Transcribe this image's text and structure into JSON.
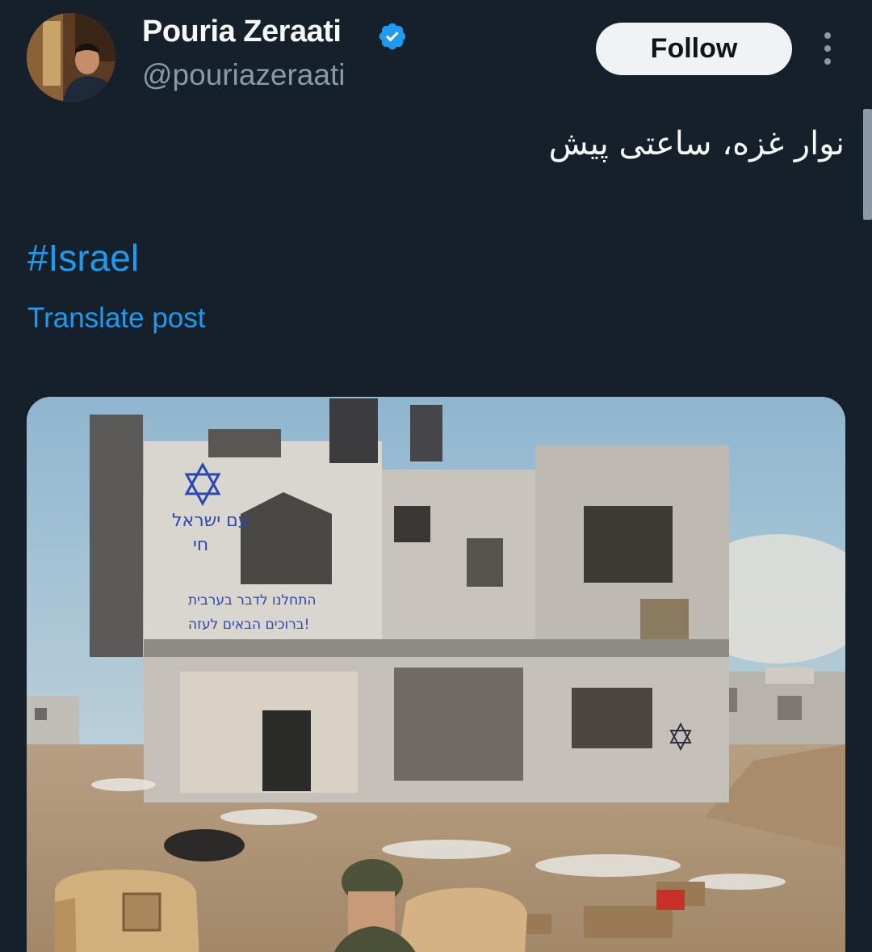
{
  "author": {
    "display_name": "Pouria Zeraati",
    "handle": "@pouriazeraati",
    "verified_icon": "verified-badge-icon",
    "avatar_icon": "avatar-photo"
  },
  "actions": {
    "follow_label": "Follow",
    "more_icon": "more-vertical-icon"
  },
  "post": {
    "text": "نوار غزه، ساعتی پیش",
    "hashtag": "#Israel",
    "translate_label": "Translate post"
  },
  "media": {
    "graffiti_lines": [
      "עם ישראל",
      "חי",
      "התחלנו לדבר בערבית",
      "ברוכים הבאים לעזה!"
    ],
    "colors": {
      "accent": "#1d9bf0",
      "background": "#15202b",
      "graffiti": "#2a48b5"
    }
  }
}
